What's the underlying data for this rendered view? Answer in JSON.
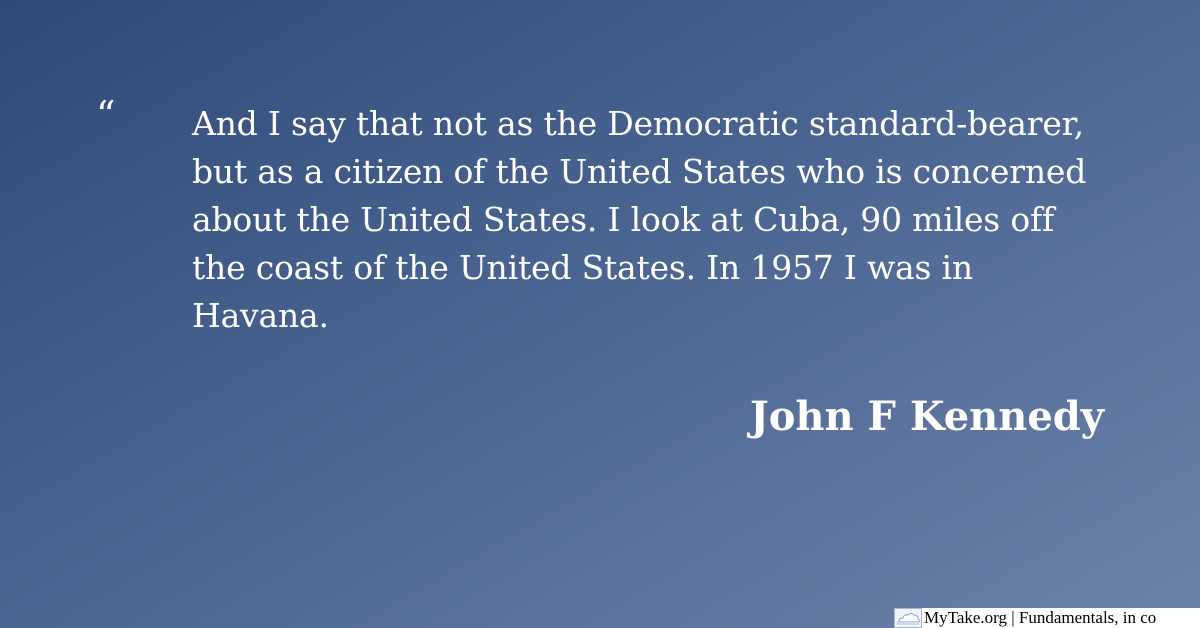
{
  "quote": {
    "mark": "“",
    "text": "And I say that not as the Democratic standard-bearer, but as a citizen of the United States who is concerned about the United States. I look at Cuba, 90 miles off the coast of the United States. In 1957 I was in Havana.",
    "author": "John F Kennedy"
  },
  "footer": {
    "icon": "cloud-icon",
    "text": "MyTake.org | Fundamentals, in co"
  },
  "colors": {
    "background_start": "#2f4a78",
    "background_end": "#6c82aa",
    "text": "#ffffff"
  }
}
